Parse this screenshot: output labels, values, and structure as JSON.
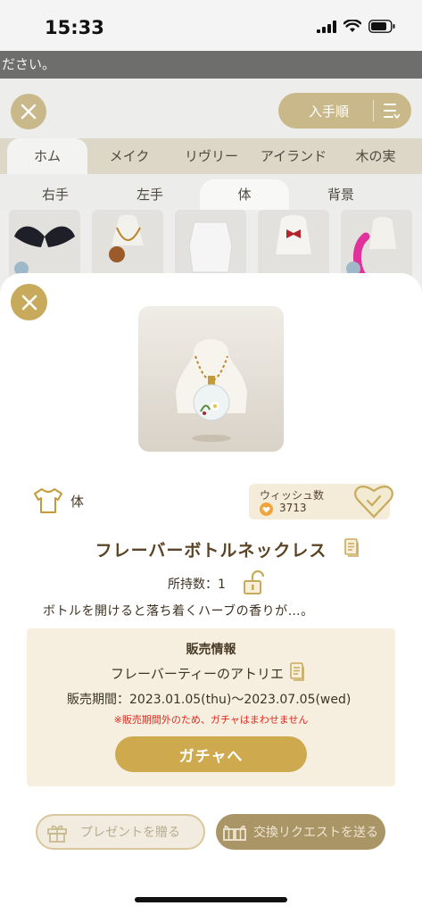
{
  "status_bar": {
    "time": "15:33"
  },
  "background": {
    "banner_text": "ださい。",
    "sort_label": "入手順",
    "tabs": [
      "ホム",
      "メイク",
      "リヴリー",
      "アイランド",
      "木の実"
    ],
    "active_tab": "ホム",
    "subtabs": [
      "右手",
      "左手",
      "体",
      "背景"
    ],
    "active_subtab": "体"
  },
  "item": {
    "category": "体",
    "wish_label": "ウィッシュ数",
    "wish_count": "3713",
    "name": "フレーバーボトルネックレス",
    "owned": "所持数：1",
    "description": "ボトルを開けると落ち着くハーブの香りが…。"
  },
  "sale_info": {
    "title": "販売情報",
    "shop": "フレーバーティーのアトリエ",
    "period": "販売期間：2023.01.05(thu)〜2023.07.05(wed)",
    "notice": "※販売期間外のため、ガチャはまわせません",
    "gacha_button": "ガチャへ"
  },
  "actions": {
    "gift_button": "プレゼントを贈る",
    "trade_button": "交換リクエストを送る"
  },
  "colors": {
    "gold": "#c8aa5c",
    "gacha_button": "#cfa94e",
    "notice_red": "#e02a1e",
    "sale_box": "#f6efe0"
  },
  "icons": [
    "signal-icon",
    "wifi-icon",
    "battery-icon",
    "close-icon",
    "sort-icon",
    "shirt-icon",
    "heart-badge-icon",
    "heart-check-icon",
    "document-icon",
    "unlock-icon",
    "gift-icon",
    "trade-icon"
  ]
}
